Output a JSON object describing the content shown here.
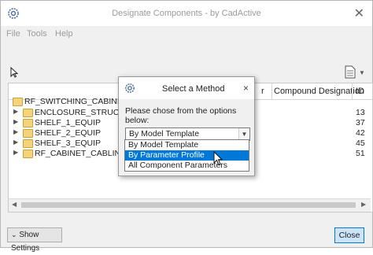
{
  "window": {
    "title": "Designate Components - by CadActive",
    "app_icon": "gear-icon",
    "close_glyph": "✕"
  },
  "menu": {
    "items": [
      "File",
      "Tools",
      "Help"
    ]
  },
  "grid": {
    "columns": [
      "Compound Designation",
      "ID"
    ],
    "hidden_column_partial": "r",
    "rows": [
      {
        "label": "RF_SWITCHING_CABINET",
        "expandable": false,
        "id": "",
        "indent": 0
      },
      {
        "label": "ENCLOSURE_STRUCTURE",
        "expandable": true,
        "id": "13",
        "indent": 1
      },
      {
        "label": "SHELF_1_EQUIP",
        "expandable": true,
        "id": "37",
        "indent": 1
      },
      {
        "label": "SHELF_2_EQUIP",
        "expandable": true,
        "id": "42",
        "indent": 1
      },
      {
        "label": "SHELF_3_EQUIP",
        "expandable": true,
        "id": "45",
        "indent": 1
      },
      {
        "label": "RF_CABINET_CABLING_ROU",
        "expandable": true,
        "id": "51",
        "indent": 1
      }
    ]
  },
  "dialog": {
    "title": "Select a Method",
    "close_glyph": "×",
    "prompt": "Please chose from the options below:",
    "selected_value": "By Model Template",
    "options": [
      "By Model Template",
      "By Parameter Profile",
      "All Component Parameters"
    ],
    "highlighted_index": 1
  },
  "footer": {
    "show_settings_label": "Show Settings",
    "close_label": "Close"
  },
  "colors": {
    "accent": "#0078d7",
    "folder": "#f4d37a"
  }
}
